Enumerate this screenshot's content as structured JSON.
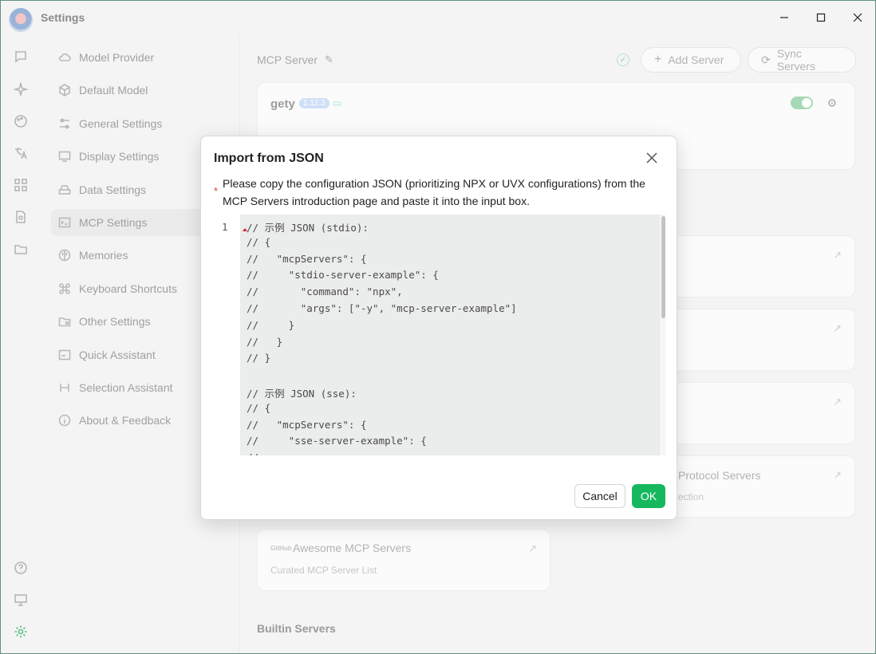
{
  "window": {
    "title": "Settings"
  },
  "nav": {
    "items": [
      {
        "label": "Model Provider",
        "icon": "cloud-icon"
      },
      {
        "label": "Default Model",
        "icon": "cube-icon"
      },
      {
        "label": "General Settings",
        "icon": "sliders-icon"
      },
      {
        "label": "Display Settings",
        "icon": "monitor-icon"
      },
      {
        "label": "Data Settings",
        "icon": "drive-icon"
      },
      {
        "label": "MCP Settings",
        "icon": "terminal-icon"
      },
      {
        "label": "Memories",
        "icon": "brain-icon"
      },
      {
        "label": "Keyboard Shortcuts",
        "icon": "command-icon"
      },
      {
        "label": "Other Settings",
        "icon": "folder-gear-icon"
      },
      {
        "label": "Quick Assistant",
        "icon": "app-window-icon"
      },
      {
        "label": "Selection Assistant",
        "icon": "text-select-icon"
      },
      {
        "label": "About & Feedback",
        "icon": "info-icon"
      }
    ],
    "active_index": 5
  },
  "main": {
    "title": "MCP Server",
    "add_server": "Add Server",
    "sync_servers": "Sync Servers",
    "server": {
      "name": "gety",
      "version": "1.12.3",
      "enabled": true
    },
    "protocol_card_title": "Protocol Servers",
    "protocol_card_sub": "ection",
    "awesome_card": {
      "badge": "GitHub",
      "title": "Awesome MCP Servers",
      "subtitle": "Curated MCP Server List"
    },
    "builtin_heading": "Builtin Servers"
  },
  "modal": {
    "title": "Import from JSON",
    "description": "Please copy the configuration JSON (prioritizing NPX or UVX configurations) from the MCP Servers introduction page and paste it into the input box.",
    "line_number": "1",
    "code_lines": [
      "// 示例 JSON (stdio):",
      "// {",
      "//   \"mcpServers\": {",
      "//     \"stdio-server-example\": {",
      "//       \"command\": \"npx\",",
      "//       \"args\": [\"-y\", \"mcp-server-example\"]",
      "//     }",
      "//   }",
      "// }",
      "",
      "// 示例 JSON (sse):",
      "// {",
      "//   \"mcpServers\": {",
      "//     \"sse-server-example\": {",
      "//"
    ],
    "cancel_label": "Cancel",
    "ok_label": "OK"
  },
  "colors": {
    "accent": "#16b85f",
    "danger": "#e23b3b"
  }
}
